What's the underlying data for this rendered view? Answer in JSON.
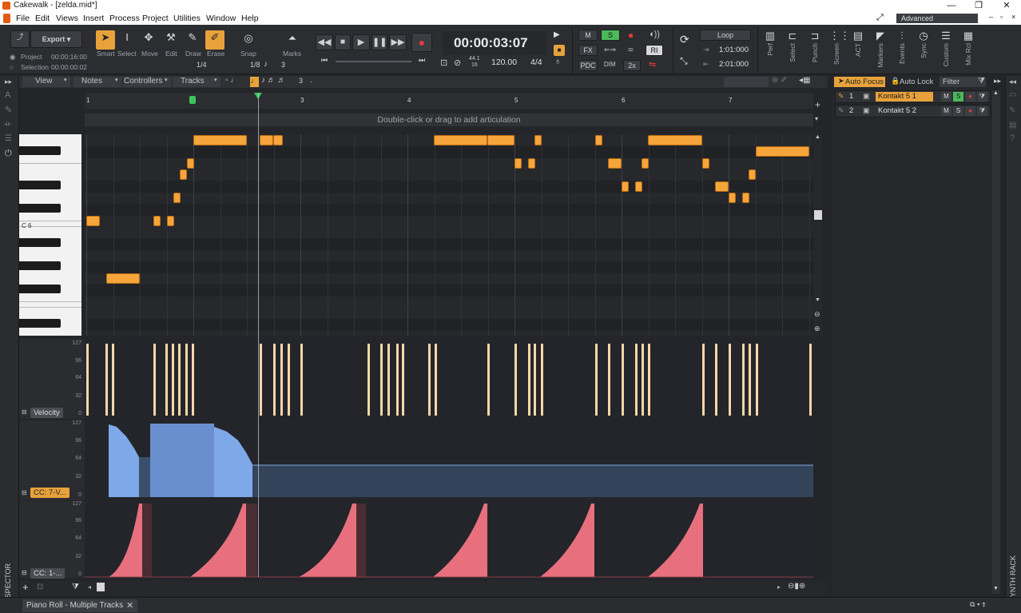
{
  "window": {
    "title": "Cakewalk - [zelda.mid*]",
    "workspace": "Advanced"
  },
  "menu": [
    "File",
    "Edit",
    "Views",
    "Insert",
    "Process",
    "Project",
    "Utilities",
    "Window",
    "Help"
  ],
  "toolbar": {
    "export_label": "Export",
    "project_label": "Project",
    "project_time": "00:00:16:00",
    "selection_label": "Selection",
    "selection_time": "00:00:00:02",
    "tools": [
      "Smart",
      "Select",
      "Move",
      "Edit",
      "Draw",
      "Erase"
    ],
    "tools_fraction": "1/4",
    "snap_label": "Snap",
    "marks_label": "Marks",
    "snap_value": "1/8",
    "snap_triplet": "3",
    "time_display": "00:00:03:07",
    "sample_rate": "44.1",
    "bit_depth": "16",
    "tempo": "120.00",
    "meter": "4/4",
    "mix_buttons": [
      "M",
      "S",
      "FX",
      "RI",
      "PDC",
      "2x"
    ],
    "loop_label": "Loop",
    "loop_start": "1:01:000",
    "loop_end": "2:01:000",
    "modules": [
      "Perf",
      "Select",
      "Punch",
      "Screen",
      "ACT",
      "Markers",
      "Events",
      "Sync",
      "Custom",
      "Mix Rcl"
    ]
  },
  "viewbar": {
    "menus": [
      "View",
      "Notes",
      "Controllers",
      "Tracks"
    ],
    "triplet": "3"
  },
  "ruler": {
    "marks": [
      "1",
      "2",
      "3",
      "4",
      "5",
      "6",
      "7"
    ]
  },
  "articulation_hint": "Double-click or drag to add articulation",
  "piano": {
    "key_label": "C 6"
  },
  "lanes": [
    {
      "label": "Velocity",
      "axis": [
        "127",
        "96",
        "64",
        "32",
        "0"
      ]
    },
    {
      "label": "CC: 7-V...",
      "axis": [
        "127",
        "96",
        "64",
        "32",
        "0"
      ]
    },
    {
      "label": "CC: 1-...",
      "axis": [
        "127",
        "96",
        "64",
        "32",
        "0"
      ]
    }
  ],
  "track_pane": {
    "auto_focus": "Auto Focus",
    "auto_lock": "Auto Lock",
    "filter": "Filter",
    "tracks": [
      {
        "num": "1",
        "name": "Kontakt 5 1"
      },
      {
        "num": "2",
        "name": "Kontakt 5 2"
      }
    ]
  },
  "left_strip_label": "INSPECTOR",
  "right_strip_label": "SYNTH RACK",
  "bottom_tab": "Piano Roll - Multiple Tracks",
  "colors": {
    "note": "#f5a53b",
    "velocity": "#f6d7a8",
    "cc7": "#7fa8e8",
    "cc1": "#e8707e",
    "accent": "#e8a23b"
  }
}
